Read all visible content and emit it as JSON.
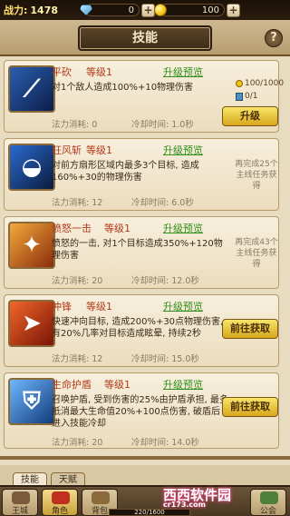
{
  "topbar": {
    "power_label": "战力:",
    "power_value": "1478",
    "gem_value": "0",
    "coin_value": "100",
    "plus": "+"
  },
  "header": {
    "title": "技能",
    "help": "?"
  },
  "cards": [
    {
      "name": "平砍",
      "level": "等级1",
      "preview": "升级预览",
      "desc": "对1个敌人造成100%+10物理伤害",
      "cost_label": "法力消耗: 0",
      "cd_label": "冷却时间: 1.0秒",
      "coin_cost": "100/1000",
      "book_cost": "0/1",
      "button": "升级"
    },
    {
      "name": "狂风斩",
      "level": "等级1",
      "preview": "升级预览",
      "desc": "对前方扇形区域内最多3个目标, 造成160%+30的物理伤害",
      "cost_label": "法力消耗: 12",
      "cd_label": "冷却时间: 6.0秒",
      "unlock": "再完成25个主线任务获得"
    },
    {
      "name": "愤怒一击",
      "level": "等级1",
      "preview": "升级预览",
      "desc": "愤怒的一击, 对1个目标造成350%+120物理伤害",
      "cost_label": "法力消耗: 20",
      "cd_label": "冷却时间: 12.0秒",
      "unlock": "再完成43个主线任务获得"
    },
    {
      "name": "冲锋",
      "level": "等级1",
      "preview": "升级预览",
      "desc": "快速冲向目标, 造成200%+30点物理伤害, 有20%几率对目标造成眩晕, 持续2秒",
      "cost_label": "法力消耗: 12",
      "cd_label": "冷却时间: 15.0秒",
      "button": "前往获取"
    },
    {
      "name": "生命护盾",
      "level": "等级1",
      "preview": "升级预览",
      "desc": "召唤护盾, 受到伤害的25%由护盾承担, 最多抵消最大生命值20%+100点伤害, 破盾后进入技能冷却",
      "cost_label": "法力消耗: 20",
      "cd_label": "冷却时间: 14.0秒",
      "button": "前往获取"
    }
  ],
  "subtabs": {
    "skills": "技能",
    "talent": "天赋"
  },
  "bottomnav": {
    "items": [
      "王城",
      "角色",
      "背包",
      "",
      "",
      "",
      "",
      "公会"
    ]
  },
  "exp": "220/1600",
  "watermark": {
    "main": "西西软件园",
    "sub": "cr173.com"
  },
  "colors": {
    "accent": "#b23a1a",
    "preview": "#2f8f19",
    "button": "#d7a71c"
  }
}
